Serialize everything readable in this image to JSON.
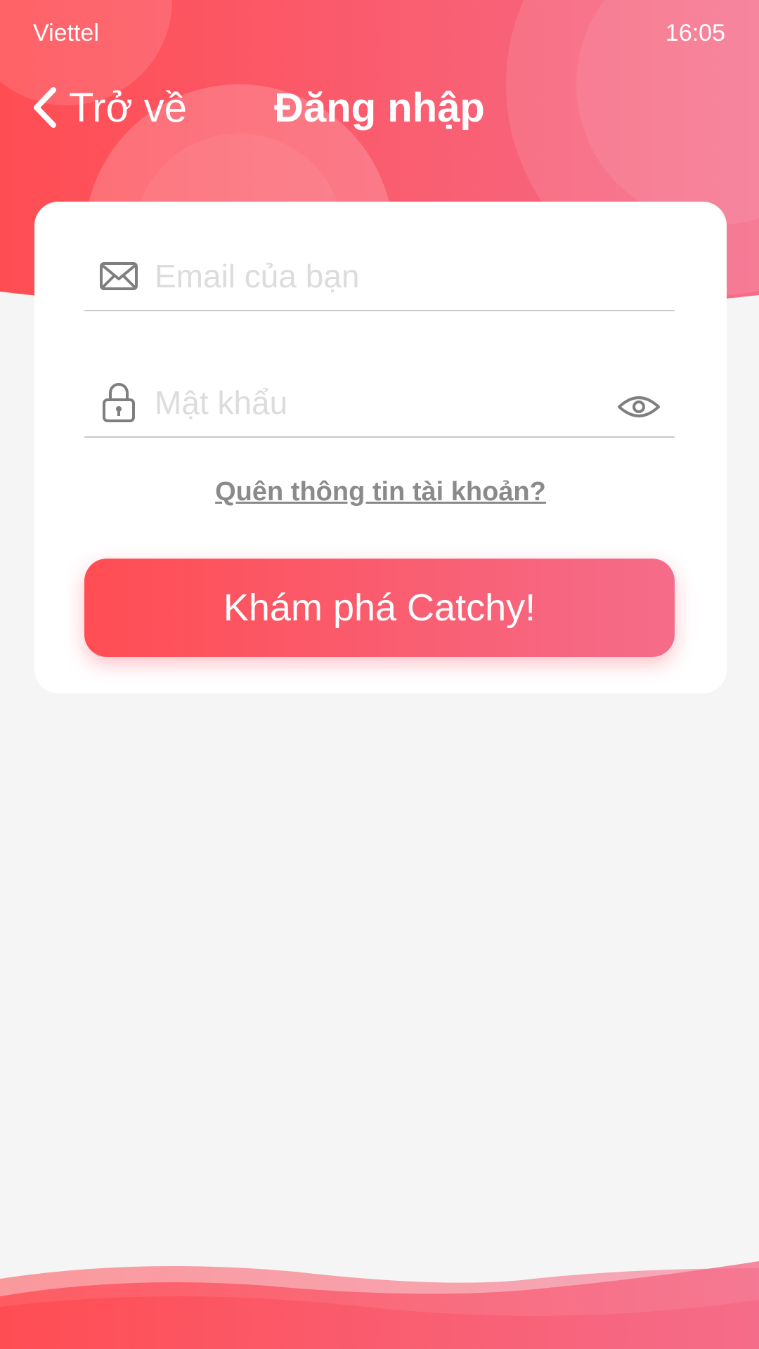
{
  "status_bar": {
    "carrier": "Viettel",
    "time": "16:05"
  },
  "nav": {
    "back_label": "Trở về",
    "title": "Đăng nhập"
  },
  "form": {
    "email_placeholder": "Email của bạn",
    "password_placeholder": "Mật khẩu",
    "forgot_label": "Quên thông tin tài khoản?",
    "submit_label": "Khám phá Catchy!"
  },
  "icons": {
    "back": "chevron-left-icon",
    "email": "envelope-icon",
    "password": "lock-icon",
    "toggle_password": "eye-icon"
  },
  "colors": {
    "accent_start": "#ff4d53",
    "accent_end": "#f56c8a",
    "background": "#f5f5f5",
    "muted_text": "#8a8a8a"
  }
}
